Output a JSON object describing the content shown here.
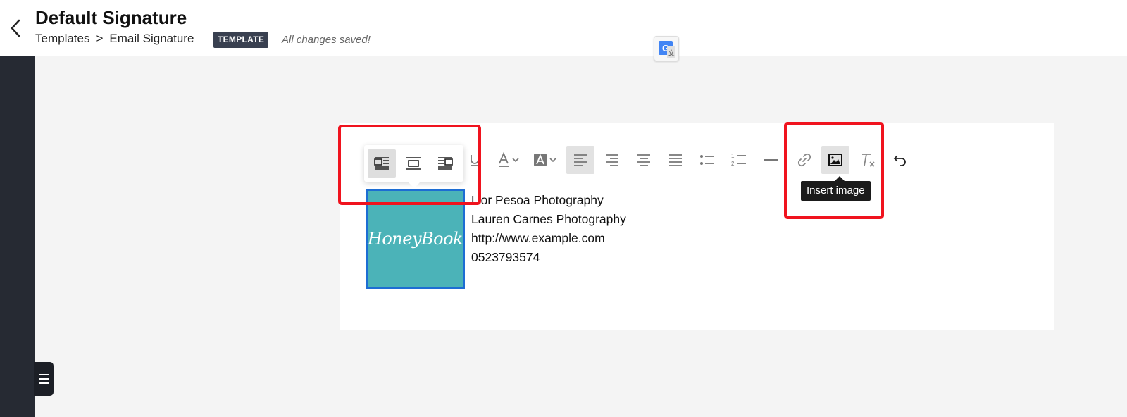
{
  "header": {
    "title": "Default Signature",
    "breadcrumb": {
      "parent": "Templates",
      "separator": ">",
      "current": "Email Signature"
    },
    "badge": "TEMPLATE",
    "save_status": "All changes saved!"
  },
  "toolbar": {
    "buttons": [
      {
        "name": "underline",
        "label": "U"
      },
      {
        "name": "text-color",
        "label": "A"
      },
      {
        "name": "highlight-color",
        "label": "A"
      },
      {
        "name": "align-left",
        "active": true
      },
      {
        "name": "align-right"
      },
      {
        "name": "align-center"
      },
      {
        "name": "align-justify"
      },
      {
        "name": "bullet-list"
      },
      {
        "name": "numbered-list"
      },
      {
        "name": "horizontal-rule"
      },
      {
        "name": "insert-link"
      },
      {
        "name": "insert-image",
        "active": true
      },
      {
        "name": "clear-formatting",
        "label": "T"
      },
      {
        "name": "undo"
      }
    ],
    "tooltip": "Insert image"
  },
  "image_popover": {
    "options": [
      "wrap-left",
      "inline",
      "wrap-right"
    ],
    "selected": "wrap-left"
  },
  "signature": {
    "logo_text": "HoneyBook",
    "lines": [
      "Lior Pesoa Photography",
      "Lauren Carnes Photography",
      "http://www.example.com",
      "0523793574"
    ]
  },
  "colors": {
    "sidebar": "#262a33",
    "badge": "#394050",
    "logo_bg": "#4bb3b8",
    "selection_border": "#1d6dd3",
    "highlight": "#f0131e"
  }
}
